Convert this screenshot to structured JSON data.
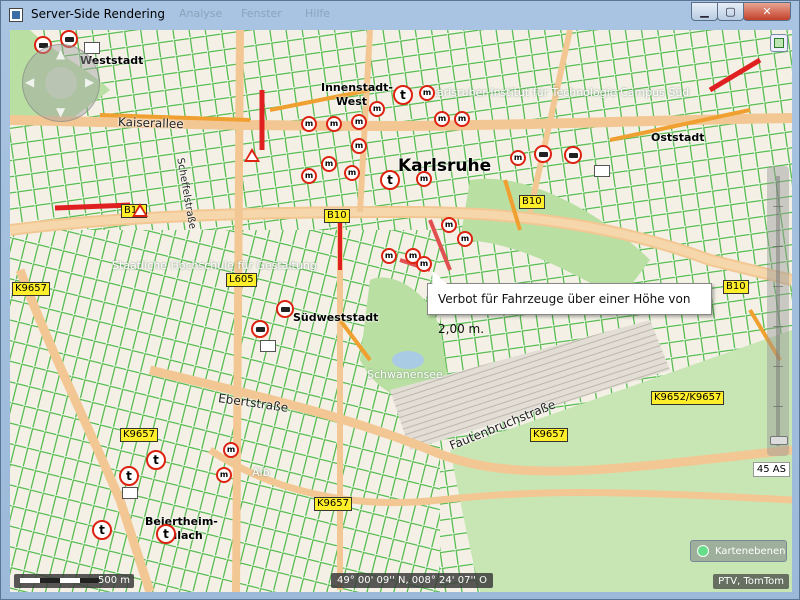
{
  "window": {
    "title": "Server-Side Rendering",
    "ghost_menu": [
      "Analyse",
      "Fenster",
      "Hilfe"
    ],
    "minimize_icon": "minimize-icon",
    "maximize_icon": "maximize-icon",
    "close_icon": "close-icon"
  },
  "map": {
    "places": {
      "weststadt": "Weststadt",
      "innenstadt_west_1": "Innenstadt-",
      "innenstadt_west_2": "West",
      "karlsruhe": "Karlsruhe",
      "oststadt": "Oststadt",
      "suedweststadt": "Südweststadt",
      "beiertheim_1": "Beiertheim-",
      "beiertheim_2": "Bulach"
    },
    "streets": {
      "kaiserallee": "Kaiserallee",
      "scheffelstrasse": "Scheffelstraße",
      "ebertstrasse": "Ebertstraße",
      "fautenbruchstrasse": "Fautenbruchstraße",
      "alb": "Alb",
      "schwanensee": "Schwanensee"
    },
    "pois": {
      "kit": "Karlsruher Institut für Technologie Campus Süd",
      "hochschule": "Staatliche Hochschule für Gestaltung"
    },
    "road_shields": [
      {
        "id": "b10-left",
        "text": "B10"
      },
      {
        "id": "b10-center",
        "text": "B10"
      },
      {
        "id": "b10-right",
        "text": "B10"
      },
      {
        "id": "b10-east",
        "text": "B10"
      },
      {
        "id": "l605",
        "text": "L605"
      },
      {
        "id": "k9657-west",
        "text": "K9657"
      },
      {
        "id": "k9657-sw",
        "text": "K9657"
      },
      {
        "id": "k9657-center",
        "text": "K9657"
      },
      {
        "id": "k9657-south",
        "text": "K9657"
      },
      {
        "id": "k9652",
        "text": "K9652/K9657"
      }
    ],
    "tooltip": "Verbot für Fahrzeuge über einer Höhe von 2,00 m.",
    "zoom_level_label": "45 AS",
    "scale_label": "500 m",
    "coordinates": "49° 00' 09'' N, 008° 24' 07'' O",
    "copyright": "PTV, TomTom",
    "layers_button": "Kartenebenen",
    "colors": {
      "green_road": "#52b848",
      "orange_road": "#f0a030",
      "red_road": "#e02020",
      "water": "#a9cbe3",
      "park": "#b9dfa3"
    }
  }
}
